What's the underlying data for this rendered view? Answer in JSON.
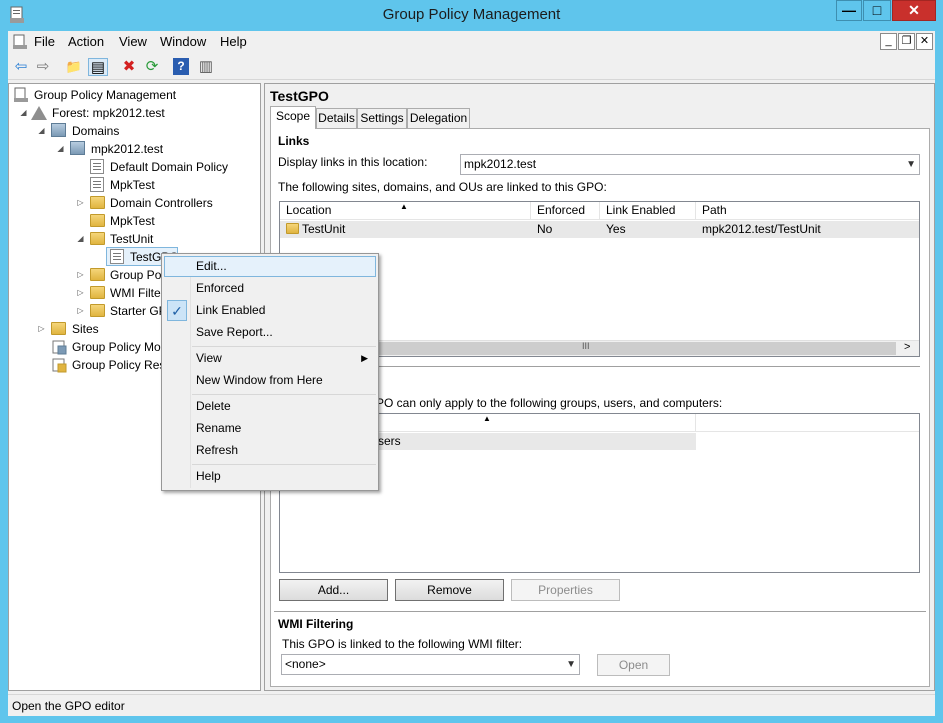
{
  "window": {
    "title": "Group Policy Management",
    "min_glyph": "—",
    "max_glyph": "□",
    "close_glyph": "✕"
  },
  "menubar": {
    "items": [
      "File",
      "Action",
      "View",
      "Window",
      "Help"
    ],
    "mdi_min": "_",
    "mdi_restore": "❐",
    "mdi_close": "✕"
  },
  "toolbar": {
    "back": "⇦",
    "forward": "⇨",
    "up": "📁",
    "show_hide": "▤",
    "delete": "✖",
    "refresh": "⟳",
    "help": "?",
    "props": "▥"
  },
  "tree": {
    "root": "Group Policy Management",
    "forest": "Forest: mpk2012.test",
    "domains": "Domains",
    "domain": "mpk2012.test",
    "default_domain_policy": "Default Domain Policy",
    "mpktest_link": "MpkTest",
    "domain_controllers": "Domain Controllers",
    "mpktest_ou": "MpkTest",
    "testunit": "TestUnit",
    "testgpo": "TestGPO",
    "group_policy_objects": "Group Po",
    "wmi_filters": "WMI Filte",
    "starter_gpos": "Starter GP",
    "sites": "Sites",
    "gp_modeling": "Group Policy Mo",
    "gp_results": "Group Policy Res"
  },
  "detail": {
    "title": "TestGPO",
    "tabs": [
      "Scope",
      "Details",
      "Settings",
      "Delegation"
    ],
    "links_heading": "Links",
    "display_links_label": "Display links in this location:",
    "display_links_value": "mpk2012.test",
    "linked_desc": "The following sites, domains, and OUs are linked to this GPO:",
    "links_columns": [
      "Location",
      "Enforced",
      "Link Enabled",
      "Path"
    ],
    "links_rows": [
      {
        "location": "TestUnit",
        "enforced": "No",
        "link_enabled": "Yes",
        "path": "mpk2012.test/TestUnit"
      }
    ],
    "hscroll_grip": "III",
    "filter_desc_partial": "PO can only apply to the following groups, users, and computers:",
    "filter_row_partial": "sers",
    "buttons": {
      "add": "Add...",
      "remove": "Remove",
      "properties": "Properties"
    },
    "wmi_heading": "WMI Filtering",
    "wmi_desc": "This GPO is linked to the following WMI filter:",
    "wmi_value": "<none>",
    "open_button": "Open"
  },
  "context_menu": {
    "items": [
      "Edit...",
      "Enforced",
      "Link Enabled",
      "Save Report...",
      "View",
      "New Window from Here",
      "Delete",
      "Rename",
      "Refresh",
      "Help"
    ],
    "check_glyph": "✓",
    "submenu_glyph": "▶"
  },
  "status": {
    "text": "Open the GPO editor"
  }
}
